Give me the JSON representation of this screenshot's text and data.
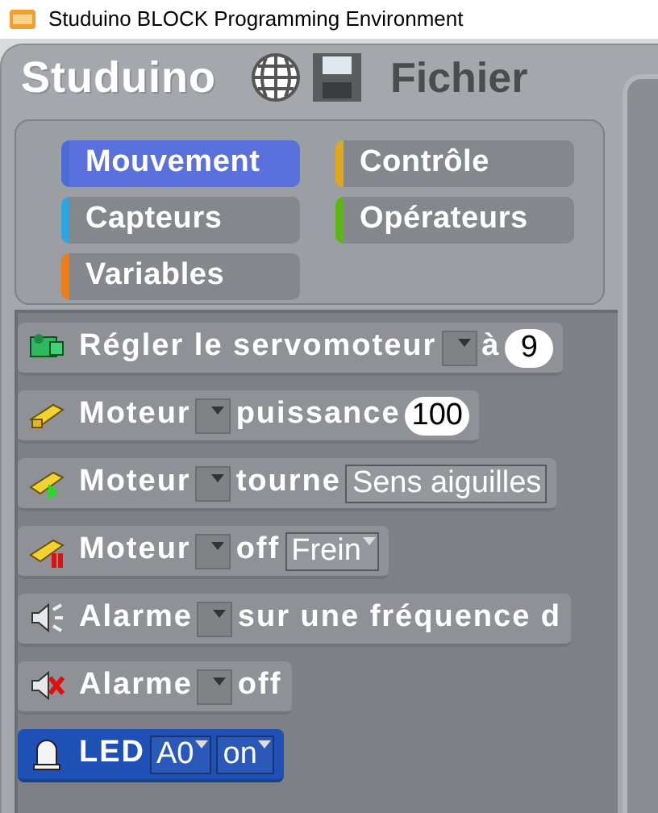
{
  "window": {
    "title": "Studuino BLOCK Programming Environment"
  },
  "toolbar": {
    "logo": "Studuino",
    "menu": "Fichier"
  },
  "categories": [
    {
      "label": "Mouvement",
      "color": "#4a6cd4",
      "selected": true
    },
    {
      "label": "Contrôle",
      "color": "#e1a91a",
      "selected": false
    },
    {
      "label": "Capteurs",
      "color": "#2ca5e2",
      "selected": false
    },
    {
      "label": "Opérateurs",
      "color": "#5cb712",
      "selected": false
    },
    {
      "label": "Variables",
      "color": "#ee7d16",
      "selected": false
    }
  ],
  "blocks": [
    {
      "color": "#8e9296",
      "parts": [
        {
          "kind": "label",
          "text": "Régler le servomoteur"
        },
        {
          "kind": "dropdown"
        },
        {
          "kind": "label",
          "text": "à"
        },
        {
          "kind": "number",
          "text": "9"
        }
      ]
    },
    {
      "color": "#8e9296",
      "parts": [
        {
          "kind": "label",
          "text": "Moteur"
        },
        {
          "kind": "dropdown"
        },
        {
          "kind": "label",
          "text": "puissance"
        },
        {
          "kind": "number",
          "text": "100"
        }
      ]
    },
    {
      "color": "#8e9296",
      "parts": [
        {
          "kind": "label",
          "text": "Moteur"
        },
        {
          "kind": "dropdown"
        },
        {
          "kind": "label",
          "text": "tourne"
        },
        {
          "kind": "menu",
          "text": "Sens aiguilles"
        }
      ]
    },
    {
      "color": "#8e9296",
      "parts": [
        {
          "kind": "label",
          "text": "Moteur"
        },
        {
          "kind": "dropdown"
        },
        {
          "kind": "label",
          "text": "off"
        },
        {
          "kind": "dropmenu",
          "text": "Frein"
        }
      ]
    },
    {
      "color": "#8e9296",
      "parts": [
        {
          "kind": "label",
          "text": "Alarme"
        },
        {
          "kind": "dropdown"
        },
        {
          "kind": "label",
          "text": "sur une fréquence d"
        }
      ]
    },
    {
      "color": "#8e9296",
      "parts": [
        {
          "kind": "label",
          "text": "Alarme"
        },
        {
          "kind": "dropdown"
        },
        {
          "kind": "label",
          "text": "off"
        }
      ]
    },
    {
      "color": "#1f50b5",
      "parts": [
        {
          "kind": "label",
          "text": "LED"
        },
        {
          "kind": "dropmenu",
          "text": "A0"
        },
        {
          "kind": "dropmenu",
          "text": "on"
        }
      ]
    }
  ]
}
